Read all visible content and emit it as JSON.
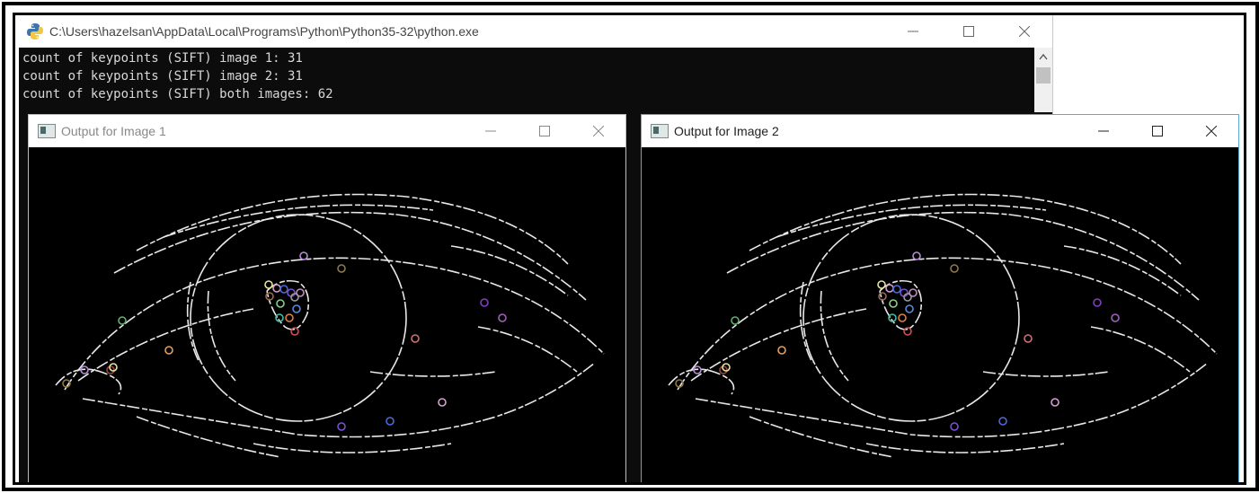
{
  "console": {
    "title": "C:\\Users\\hazelsan\\AppData\\Local\\Programs\\Python\\Python35-32\\python.exe",
    "lines": [
      "count of keypoints (SIFT) image 1: 31",
      "count of keypoints (SIFT) image 2: 31",
      "count of keypoints (SIFT) both images: 62"
    ],
    "icon": "python-icon"
  },
  "window1": {
    "title": "Output for Image 1",
    "active": false
  },
  "window2": {
    "title": "Output for Image 2",
    "active": true
  },
  "controls": {
    "minimize": "minimize-icon",
    "maximize": "maximize-icon",
    "close": "close-icon"
  },
  "keypoint_colors": [
    "#b58cd6",
    "#8c7a4a",
    "#e6e6a0",
    "#d8a0d0",
    "#4a6ad8",
    "#7a50d0",
    "#9a9a9a",
    "#9a6a50",
    "#8ad08a",
    "#c090c0",
    "#5a8ad8",
    "#e08040",
    "#40c0a0",
    "#d05050",
    "#8040c0",
    "#a060c0",
    "#60b070",
    "#d07070",
    "#e0a060",
    "#a04040"
  ]
}
